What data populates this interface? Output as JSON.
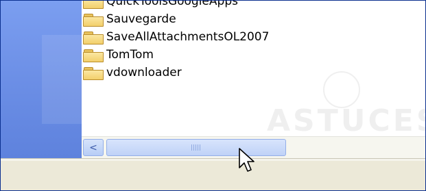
{
  "folders": [
    {
      "name": "QuickToolsGoogleApps",
      "icon": "folder-icon"
    },
    {
      "name": "Sauvegarde",
      "icon": "folder-icon"
    },
    {
      "name": "SaveAllAttachmentsOL2007",
      "icon": "folder-icon"
    },
    {
      "name": "TomTom",
      "icon": "folder-icon"
    },
    {
      "name": "vdownloader",
      "icon": "folder-icon"
    }
  ],
  "scrollbar": {
    "left_arrow": "<",
    "icon": "chevron-left-icon"
  },
  "watermark": {
    "text": "ASTUCES"
  },
  "colors": {
    "side_panel": "#6c8fe6",
    "status_bar": "#ece9d8",
    "scroll_thumb": "#c7d7f8",
    "frame_border": "#0a2f8f"
  }
}
